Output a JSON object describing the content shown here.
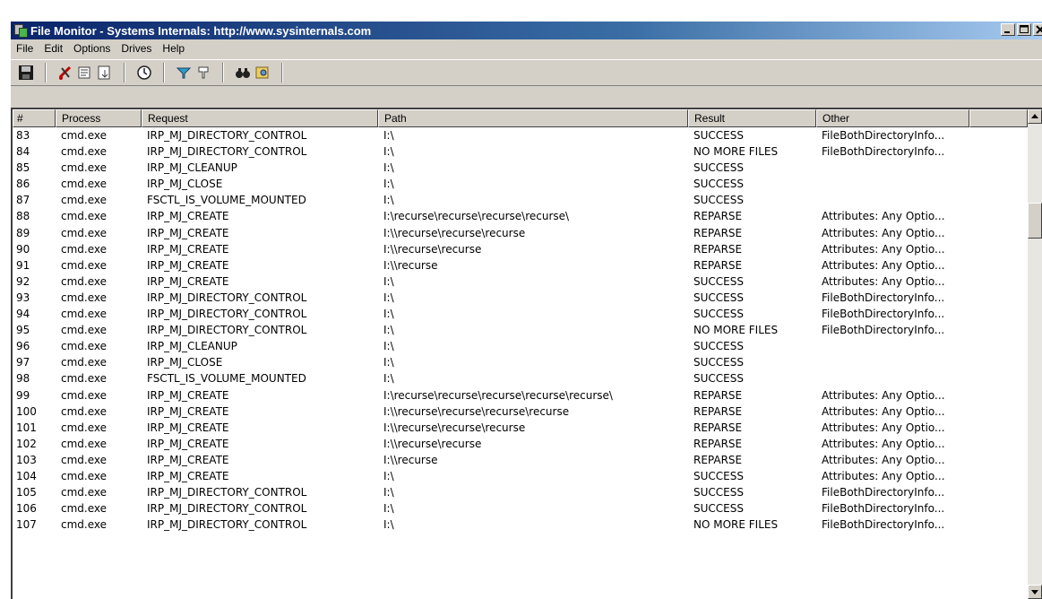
{
  "window": {
    "title": "File Monitor - Systems Internals: http://www.sysinternals.com"
  },
  "menu": [
    "File",
    "Edit",
    "Options",
    "Drives",
    "Help"
  ],
  "toolbar": {
    "icons": [
      "save-icon",
      "clear-icon",
      "capture-icon",
      "autoscroll-icon",
      "time-icon",
      "filter-icon",
      "highlight-icon",
      "find-icon",
      "explorer-jump-icon"
    ]
  },
  "columns": [
    "#",
    "Process",
    "Request",
    "Path",
    "Result",
    "Other"
  ],
  "rows": [
    [
      "83",
      "cmd.exe",
      "IRP_MJ_DIRECTORY_CONTROL",
      "I:\\",
      "SUCCESS",
      "FileBothDirectoryInfo..."
    ],
    [
      "84",
      "cmd.exe",
      "IRP_MJ_DIRECTORY_CONTROL",
      "I:\\",
      "NO MORE FILES",
      "FileBothDirectoryInfo..."
    ],
    [
      "85",
      "cmd.exe",
      "IRP_MJ_CLEANUP",
      "I:\\",
      "SUCCESS",
      ""
    ],
    [
      "86",
      "cmd.exe",
      "IRP_MJ_CLOSE",
      "I:\\",
      "SUCCESS",
      ""
    ],
    [
      "87",
      "cmd.exe",
      "FSCTL_IS_VOLUME_MOUNTED",
      "I:\\",
      "SUCCESS",
      ""
    ],
    [
      "88",
      "cmd.exe",
      "IRP_MJ_CREATE",
      "I:\\recurse\\recurse\\recurse\\recurse\\",
      "REPARSE",
      "Attributes: Any Optio..."
    ],
    [
      "89",
      "cmd.exe",
      "IRP_MJ_CREATE",
      "I:\\\\recurse\\recurse\\recurse",
      "REPARSE",
      "Attributes: Any Optio..."
    ],
    [
      "90",
      "cmd.exe",
      "IRP_MJ_CREATE",
      "I:\\\\recurse\\recurse",
      "REPARSE",
      "Attributes: Any Optio..."
    ],
    [
      "91",
      "cmd.exe",
      "IRP_MJ_CREATE",
      "I:\\\\recurse",
      "REPARSE",
      "Attributes: Any Optio..."
    ],
    [
      "92",
      "cmd.exe",
      "IRP_MJ_CREATE",
      "I:\\",
      "SUCCESS",
      "Attributes: Any Optio..."
    ],
    [
      "93",
      "cmd.exe",
      "IRP_MJ_DIRECTORY_CONTROL",
      "I:\\",
      "SUCCESS",
      "FileBothDirectoryInfo..."
    ],
    [
      "94",
      "cmd.exe",
      "IRP_MJ_DIRECTORY_CONTROL",
      "I:\\",
      "SUCCESS",
      "FileBothDirectoryInfo..."
    ],
    [
      "95",
      "cmd.exe",
      "IRP_MJ_DIRECTORY_CONTROL",
      "I:\\",
      "NO MORE FILES",
      "FileBothDirectoryInfo..."
    ],
    [
      "96",
      "cmd.exe",
      "IRP_MJ_CLEANUP",
      "I:\\",
      "SUCCESS",
      ""
    ],
    [
      "97",
      "cmd.exe",
      "IRP_MJ_CLOSE",
      "I:\\",
      "SUCCESS",
      ""
    ],
    [
      "98",
      "cmd.exe",
      "FSCTL_IS_VOLUME_MOUNTED",
      "I:\\",
      "SUCCESS",
      ""
    ],
    [
      "99",
      "cmd.exe",
      "IRP_MJ_CREATE",
      "I:\\recurse\\recurse\\recurse\\recurse\\recurse\\",
      "REPARSE",
      "Attributes: Any Optio..."
    ],
    [
      "100",
      "cmd.exe",
      "IRP_MJ_CREATE",
      "I:\\\\recurse\\recurse\\recurse\\recurse",
      "REPARSE",
      "Attributes: Any Optio..."
    ],
    [
      "101",
      "cmd.exe",
      "IRP_MJ_CREATE",
      "I:\\\\recurse\\recurse\\recurse",
      "REPARSE",
      "Attributes: Any Optio..."
    ],
    [
      "102",
      "cmd.exe",
      "IRP_MJ_CREATE",
      "I:\\\\recurse\\recurse",
      "REPARSE",
      "Attributes: Any Optio..."
    ],
    [
      "103",
      "cmd.exe",
      "IRP_MJ_CREATE",
      "I:\\\\recurse",
      "REPARSE",
      "Attributes: Any Optio..."
    ],
    [
      "104",
      "cmd.exe",
      "IRP_MJ_CREATE",
      "I:\\",
      "SUCCESS",
      "Attributes: Any Optio..."
    ],
    [
      "105",
      "cmd.exe",
      "IRP_MJ_DIRECTORY_CONTROL",
      "I:\\",
      "SUCCESS",
      "FileBothDirectoryInfo..."
    ],
    [
      "106",
      "cmd.exe",
      "IRP_MJ_DIRECTORY_CONTROL",
      "I:\\",
      "SUCCESS",
      "FileBothDirectoryInfo..."
    ],
    [
      "107",
      "cmd.exe",
      "IRP_MJ_DIRECTORY_CONTROL",
      "I:\\",
      "NO MORE FILES",
      "FileBothDirectoryInfo..."
    ]
  ]
}
